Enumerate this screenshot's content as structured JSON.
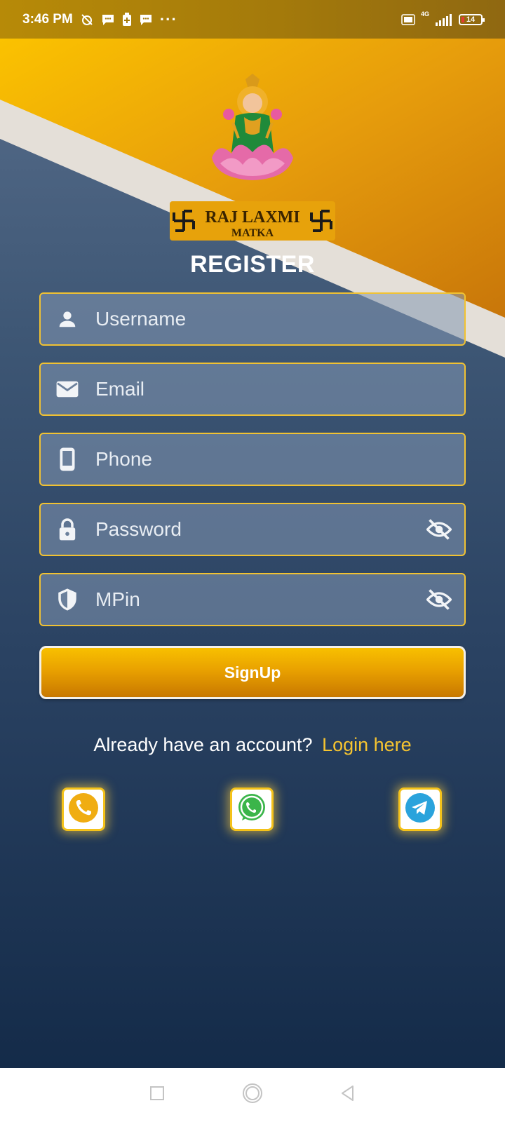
{
  "status_bar": {
    "time": "3:46 PM",
    "more": "···",
    "network": "4G",
    "battery": "14"
  },
  "logo": {
    "brand_line1": "RAJ LAXMI",
    "brand_line2": "MATKA"
  },
  "title": "REGISTER",
  "form": {
    "username": {
      "placeholder": "Username",
      "icon": "person-icon"
    },
    "email": {
      "placeholder": "Email",
      "icon": "mail-icon"
    },
    "phone": {
      "placeholder": "Phone",
      "icon": "phone-icon"
    },
    "password": {
      "placeholder": "Password",
      "icon": "lock-icon",
      "toggle_icon": "eye-off-icon"
    },
    "mpin": {
      "placeholder": "MPin",
      "icon": "shield-icon",
      "toggle_icon": "eye-off-icon"
    }
  },
  "signup_label": "SignUp",
  "login_prompt": {
    "text": "Already have an account?",
    "link": "Login here"
  },
  "social": [
    {
      "icon": "call-icon"
    },
    {
      "icon": "whatsapp-icon"
    },
    {
      "icon": "telegram-icon"
    }
  ],
  "colors": {
    "accent": "#f1c232",
    "link": "#f6c430",
    "background_top": "#566c8a",
    "background_bottom": "#142b49",
    "banner_gold": "#e7a20b"
  }
}
